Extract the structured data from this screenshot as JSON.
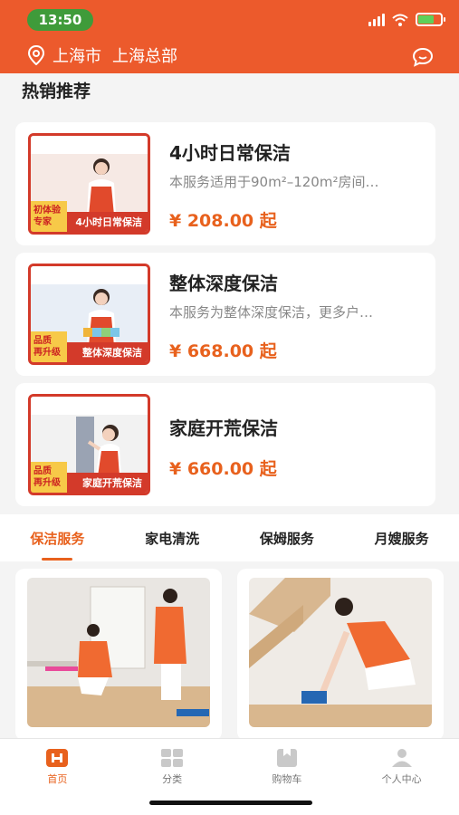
{
  "status_bar": {
    "time": "13:50"
  },
  "header": {
    "city": "上海市",
    "branch": "上海总部"
  },
  "section_title": "热销推荐",
  "products": [
    {
      "title": "4小时日常保洁",
      "desc": "本服务适用于90m²–120m²房间…",
      "price": "¥ 208.00 起",
      "badge": "初体验\n专家",
      "thumb_label": "4小时日常保洁"
    },
    {
      "title": "整体深度保洁",
      "desc": "本服务为整体深度保洁，更多户…",
      "price": "¥ 668.00 起",
      "badge": "品质\n再升级",
      "thumb_label": "整体深度保洁"
    },
    {
      "title": "家庭开荒保洁",
      "desc": "",
      "price": "¥ 660.00 起",
      "badge": "品质\n再升级",
      "thumb_label": "家庭开荒保洁"
    }
  ],
  "tabs": [
    {
      "label": "保洁服务",
      "active": true
    },
    {
      "label": "家电清洗",
      "active": false
    },
    {
      "label": "保姆服务",
      "active": false
    },
    {
      "label": "月嫂服务",
      "active": false
    }
  ],
  "bottom_nav": [
    {
      "label": "首页",
      "icon": "home-icon",
      "active": true
    },
    {
      "label": "分类",
      "icon": "grid-icon",
      "active": false
    },
    {
      "label": "购物车",
      "icon": "cart-icon",
      "active": false
    },
    {
      "label": "个人中心",
      "icon": "user-icon",
      "active": false
    }
  ],
  "colors": {
    "accent": "#ec5a2c",
    "price": "#e8611d",
    "status_time_bg": "#3f9b3a"
  }
}
